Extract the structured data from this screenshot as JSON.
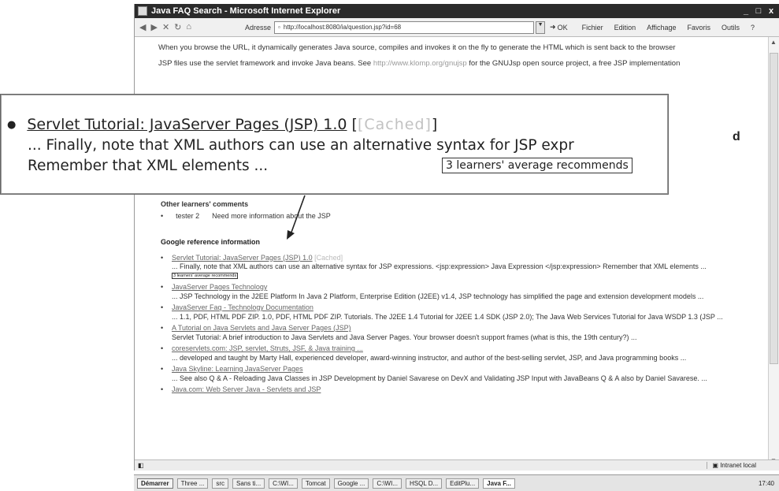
{
  "window": {
    "title": "Java FAQ Search - Microsoft Internet Explorer",
    "controls": [
      "_",
      "□",
      "x"
    ]
  },
  "toolbar": {
    "address_label": "Adresse",
    "address_value": "http://localhost:8080/ia/question.jsp?id=68",
    "go_label": "OK",
    "menu": [
      "Fichier",
      "Edition",
      "Affichage",
      "Favoris",
      "Outils",
      "?"
    ]
  },
  "content": {
    "para1": "When you browse the URL, it dynamically generates Java source, compiles and invokes it on the fly to generate the HTML which is sent back to the browser",
    "para2_start": "JSP files use the servlet framework and invoke Java beans. See",
    "para2_end": "for the GNUJsp open source project, a free JSP implementation",
    "stray_char": "d"
  },
  "comments": {
    "heading": "Other learners' comments",
    "items": [
      {
        "user": "tester 2",
        "text": "Need more information about the JSP"
      }
    ]
  },
  "zoom": {
    "title_link": "Servlet Tutorial: JavaServer Pages (JSP) 1.0",
    "cached": "[Cached]",
    "line2": "... Finally, note that XML authors can use an alternative syntax for JSP expr",
    "line3": "Remember that XML elements ...",
    "badge": "3 learners' average recommends"
  },
  "google": {
    "heading": "Google reference information",
    "results": [
      {
        "title": "Servlet Tutorial: JavaServer Pages (JSP) 1.0",
        "cached": "[Cached]",
        "snippet": "... Finally, note that XML authors can use an alternative syntax for JSP expressions. <jsp:expression> Java Expression </jsp:expression> Remember that XML elements ...",
        "badge": "3 learners' average recommends"
      },
      {
        "title": "JavaServer Pages Technology",
        "snippet": "... JSP Technology in the J2EE Platform In Java 2 Platform, Enterprise Edition (J2EE) v1.4, JSP technology has simplified the page and extension development models ..."
      },
      {
        "title": "JavaServer Faq - Technology Documentation",
        "snippet": "... 1.1, PDF, HTML PDF ZIP. 1.0, PDF, HTML PDF ZIP. Tutorials. The J2EE 1.4 Tutorial for J2EE 1.4 SDK (JSP 2.0); The Java Web Services Tutorial for Java WSDP 1.3 (JSP ..."
      },
      {
        "title": "A Tutorial on Java Servlets and Java Server Pages (JSP)",
        "snippet": "Servlet Tutorial: A brief introduction to Java Servlets and Java Server Pages. Your browser doesn't support frames (what is this, the 19th century?) ..."
      },
      {
        "title": "coreservlets.com: JSP, servlet, Struts, JSF, & Java training ...",
        "snippet": "... developed and taught by Marty Hall, experienced developer, award-winning instructor, and author of the best-selling servlet, JSP, and Java programming books ..."
      },
      {
        "title": "Java Skyline: Learning JavaServer Pages",
        "snippet": "... See also Q & A - Reloading Java Classes in JSP Development by Daniel Savarese on DevX and Validating JSP Input with JavaBeans Q & A also by Daniel Savarese. ..."
      },
      {
        "title": "Java.com: Web Server Java - Servlets and JSP",
        "snippet": ""
      }
    ]
  },
  "status": {
    "left": "",
    "zone": "Intranet local"
  },
  "taskbar": {
    "start": "Démarrer",
    "tasks": [
      "Three ...",
      "src",
      "Sans ti...",
      "C:\\WI...",
      "Tomcat",
      "Google ...",
      "C:\\WI...",
      "HSQL D...",
      "EditPlu...",
      "Java F..."
    ],
    "clock": "17:40"
  }
}
